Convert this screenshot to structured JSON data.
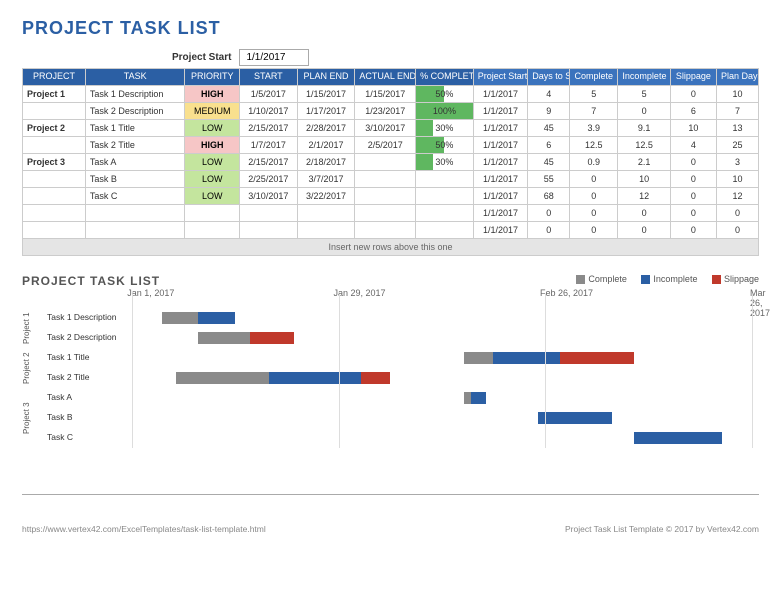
{
  "title": "PROJECT TASK LIST",
  "project_start_label": "Project Start",
  "project_start_value": "1/1/2017",
  "columns": {
    "project": "PROJECT",
    "task": "TASK",
    "priority": "PRIORITY",
    "start": "START",
    "plan_end": "PLAN END",
    "actual_end": "ACTUAL END",
    "pct": "% COMPLETE",
    "proj_start": "Project Start",
    "days_to_start": "Days to Start",
    "complete": "Complete",
    "incomplete": "Incomplete",
    "slippage": "Slippage",
    "plan_days": "Plan Days"
  },
  "rows": [
    {
      "project": "Project 1",
      "task": "Task 1 Description",
      "priority": "HIGH",
      "start": "1/5/2017",
      "plan_end": "1/15/2017",
      "actual_end": "1/15/2017",
      "pct": 50,
      "proj_start": "1/1/2017",
      "days_to_start": 4,
      "complete": 5,
      "incomplete": 5,
      "slippage": 0,
      "plan_days": 10
    },
    {
      "project": "",
      "task": "Task 2 Description",
      "priority": "MEDIUM",
      "start": "1/10/2017",
      "plan_end": "1/17/2017",
      "actual_end": "1/23/2017",
      "pct": 100,
      "proj_start": "1/1/2017",
      "days_to_start": 9,
      "complete": 7,
      "incomplete": 0,
      "slippage": 6,
      "plan_days": 7
    },
    {
      "project": "Project 2",
      "task": "Task 1 Title",
      "priority": "LOW",
      "start": "2/15/2017",
      "plan_end": "2/28/2017",
      "actual_end": "3/10/2017",
      "pct": 30,
      "proj_start": "1/1/2017",
      "days_to_start": 45,
      "complete": 3.9,
      "incomplete": 9.1,
      "slippage": 10,
      "plan_days": 13
    },
    {
      "project": "",
      "task": "Task 2 Title",
      "priority": "HIGH",
      "start": "1/7/2017",
      "plan_end": "2/1/2017",
      "actual_end": "2/5/2017",
      "pct": 50,
      "proj_start": "1/1/2017",
      "days_to_start": 6,
      "complete": 12.5,
      "incomplete": 12.5,
      "slippage": 4,
      "plan_days": 25
    },
    {
      "project": "Project 3",
      "task": "Task A",
      "priority": "LOW",
      "start": "2/15/2017",
      "plan_end": "2/18/2017",
      "actual_end": "",
      "pct": 30,
      "proj_start": "1/1/2017",
      "days_to_start": 45,
      "complete": 0.9,
      "incomplete": 2.1,
      "slippage": 0,
      "plan_days": 3
    },
    {
      "project": "",
      "task": "Task B",
      "priority": "LOW",
      "start": "2/25/2017",
      "plan_end": "3/7/2017",
      "actual_end": "",
      "pct": "",
      "proj_start": "1/1/2017",
      "days_to_start": 55,
      "complete": 0,
      "incomplete": 10,
      "slippage": 0,
      "plan_days": 10
    },
    {
      "project": "",
      "task": "Task C",
      "priority": "LOW",
      "start": "3/10/2017",
      "plan_end": "3/22/2017",
      "actual_end": "",
      "pct": "",
      "proj_start": "1/1/2017",
      "days_to_start": 68,
      "complete": 0,
      "incomplete": 12,
      "slippage": 0,
      "plan_days": 12
    },
    {
      "project": "",
      "task": "",
      "priority": "",
      "start": "",
      "plan_end": "",
      "actual_end": "",
      "pct": "",
      "proj_start": "1/1/2017",
      "days_to_start": 0,
      "complete": 0,
      "incomplete": 0,
      "slippage": 0,
      "plan_days": 0
    },
    {
      "project": "",
      "task": "",
      "priority": "",
      "start": "",
      "plan_end": "",
      "actual_end": "",
      "pct": "",
      "proj_start": "1/1/2017",
      "days_to_start": 0,
      "complete": 0,
      "incomplete": 0,
      "slippage": 0,
      "plan_days": 0
    }
  ],
  "insert_row_text": "Insert new rows above this one",
  "chart": {
    "title": "PROJECT TASK LIST",
    "legend": {
      "complete": "Complete",
      "incomplete": "Incomplete",
      "slippage": "Slippage"
    },
    "date_ticks": [
      "Jan 1, 2017",
      "Jan 29, 2017",
      "Feb 26, 2017",
      "Mar 26, 2017"
    ],
    "groups": [
      {
        "name": "Project 1",
        "tasks": [
          "Task 1 Description",
          "Task 2 Description"
        ]
      },
      {
        "name": "Project 2",
        "tasks": [
          "Task 1 Title",
          "Task 2 Title"
        ]
      },
      {
        "name": "Project 3",
        "tasks": [
          "Task A",
          "Task B",
          "Task C"
        ]
      }
    ]
  },
  "chart_data": {
    "type": "bar",
    "title": "PROJECT TASK LIST",
    "x_start": "2017-01-01",
    "x_end": "2017-03-26",
    "x_ticks": [
      "Jan 1, 2017",
      "Jan 29, 2017",
      "Feb 26, 2017",
      "Mar 26, 2017"
    ],
    "series_names": [
      "Complete",
      "Incomplete",
      "Slippage"
    ],
    "tasks": [
      {
        "group": "Project 1",
        "name": "Task 1 Description",
        "start_offset_days": 4,
        "complete": 5,
        "incomplete": 5,
        "slippage": 0
      },
      {
        "group": "Project 1",
        "name": "Task 2 Description",
        "start_offset_days": 9,
        "complete": 7,
        "incomplete": 0,
        "slippage": 6
      },
      {
        "group": "Project 2",
        "name": "Task 1 Title",
        "start_offset_days": 45,
        "complete": 3.9,
        "incomplete": 9.1,
        "slippage": 10
      },
      {
        "group": "Project 2",
        "name": "Task 2 Title",
        "start_offset_days": 6,
        "complete": 12.5,
        "incomplete": 12.5,
        "slippage": 4
      },
      {
        "group": "Project 3",
        "name": "Task A",
        "start_offset_days": 45,
        "complete": 0.9,
        "incomplete": 2.1,
        "slippage": 0
      },
      {
        "group": "Project 3",
        "name": "Task B",
        "start_offset_days": 55,
        "complete": 0,
        "incomplete": 10,
        "slippage": 0
      },
      {
        "group": "Project 3",
        "name": "Task C",
        "start_offset_days": 68,
        "complete": 0,
        "incomplete": 12,
        "slippage": 0
      }
    ]
  },
  "footer": {
    "left": "https://www.vertex42.com/ExcelTemplates/task-list-template.html",
    "right": "Project Task List Template © 2017 by Vertex42.com"
  }
}
